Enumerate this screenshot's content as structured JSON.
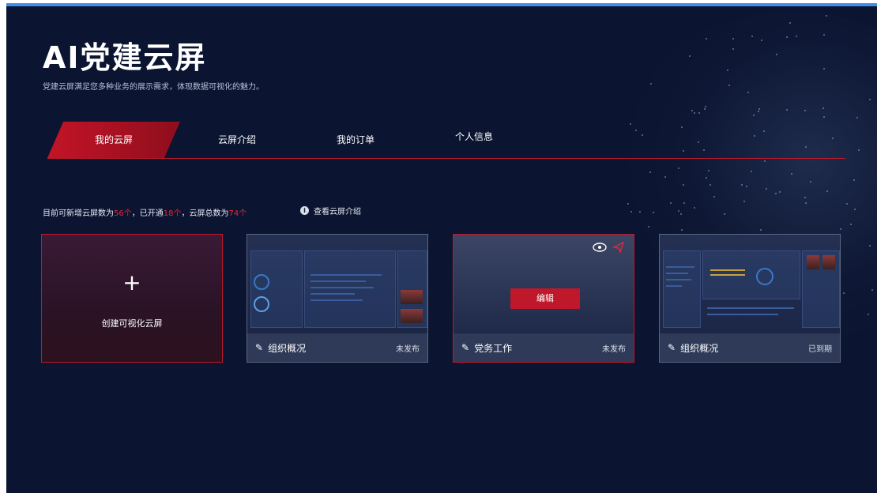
{
  "app": {
    "title": "AI党建云屏",
    "subtitle": "党建云屏满足您多种业务的展示需求，体现数据可视化的魅力。"
  },
  "tabs": [
    {
      "label": "我的云屏",
      "active": true
    },
    {
      "label": "云屏介绍",
      "active": false
    },
    {
      "label": "我的订单",
      "active": false
    },
    {
      "label": "个人信息",
      "active": false
    }
  ],
  "stats": {
    "prefix": "目前可新增云屏数为",
    "available": "56个",
    "opened_label": "，已开通",
    "opened": "18个",
    "total_label": "，云屏总数为",
    "total": "74个"
  },
  "info_link": {
    "icon": "info-icon",
    "label": "查看云屏介绍"
  },
  "create_card": {
    "icon": "plus-icon",
    "label": "创建可视化云屏"
  },
  "screens": [
    {
      "name": "组织概况",
      "status": "未发布",
      "icon": "pencil-icon"
    },
    {
      "name": "党务工作",
      "status": "未发布",
      "icon": "pencil-icon",
      "action_label": "编辑"
    },
    {
      "name": "组织概况",
      "status": "已到期",
      "icon": "pencil-icon"
    }
  ],
  "colors": {
    "background": "#0b1430",
    "accent": "#c0182b",
    "topbar": "#3f8eea",
    "card_footer": "#2e3a57"
  }
}
